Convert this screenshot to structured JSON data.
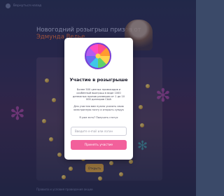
{
  "topbar": {
    "back_label": "Вернуться назад"
  },
  "hero": {
    "title": "Новогодний розыгрыш призов от",
    "title_highlight": "Эдмунда Велье"
  },
  "background": {
    "button_label": "Открыть",
    "footer_note": "Правила и условия проведения акции"
  },
  "modal": {
    "icon": "fortune-wheel-icon",
    "title": "Участие в розыгрыше",
    "text_1": "Более 500 ценных промокодов и особенный выигрыш в виде 1000 денежных призов размером от 1 до 10 000 долларов США",
    "text_2": "Для участия вам нужно указать свою электронную почту и открыть сундук",
    "text_3": "Я уже есть? Получить статус",
    "email_placeholder": "Введите e-mail или логин",
    "submit_label": "Принять участие"
  },
  "colors": {
    "accent": "#f2609b",
    "highlight": "#ff6b2d",
    "coin": "#e9a22b"
  }
}
